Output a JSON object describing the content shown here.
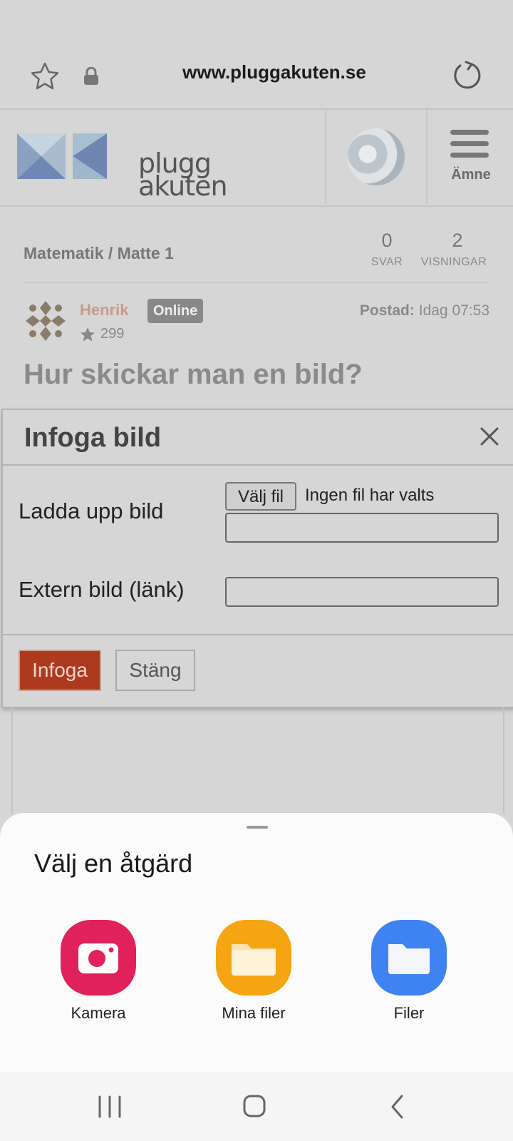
{
  "browser": {
    "url": "www.pluggakuten.se"
  },
  "site": {
    "logo_text_line1": "plugg",
    "logo_text_line2": "akuten",
    "menu_label": "Ämne"
  },
  "post": {
    "breadcrumb": "Matematik / Matte 1",
    "stats": [
      {
        "value": "0",
        "label": "SVAR"
      },
      {
        "value": "2",
        "label": "VISNINGAR"
      }
    ],
    "author": {
      "name": "Henrik",
      "status": "Online",
      "reputation": "299"
    },
    "posted_label": "Postad:",
    "posted_time": "Idag 07:53",
    "title": "Hur skickar man en bild?"
  },
  "dialog": {
    "title": "Infoga bild",
    "upload_label": "Ladda upp bild",
    "file_button": "Välj fil",
    "file_status": "Ingen fil har valts",
    "external_label": "Extern bild (länk)",
    "insert_button": "Infoga",
    "close_button": "Stäng"
  },
  "sheet": {
    "title": "Välj en åtgärd",
    "apps": [
      {
        "label": "Kamera",
        "icon": "camera-icon",
        "color": "#e0215a"
      },
      {
        "label": "Mina filer",
        "icon": "my-files-icon",
        "color": "#f5a412"
      },
      {
        "label": "Filer",
        "icon": "files-icon",
        "color": "#3f82f2"
      }
    ]
  },
  "colors": {
    "insert_button": "#ad3a1f",
    "username": "#c79a8c",
    "badge": "#888888"
  }
}
